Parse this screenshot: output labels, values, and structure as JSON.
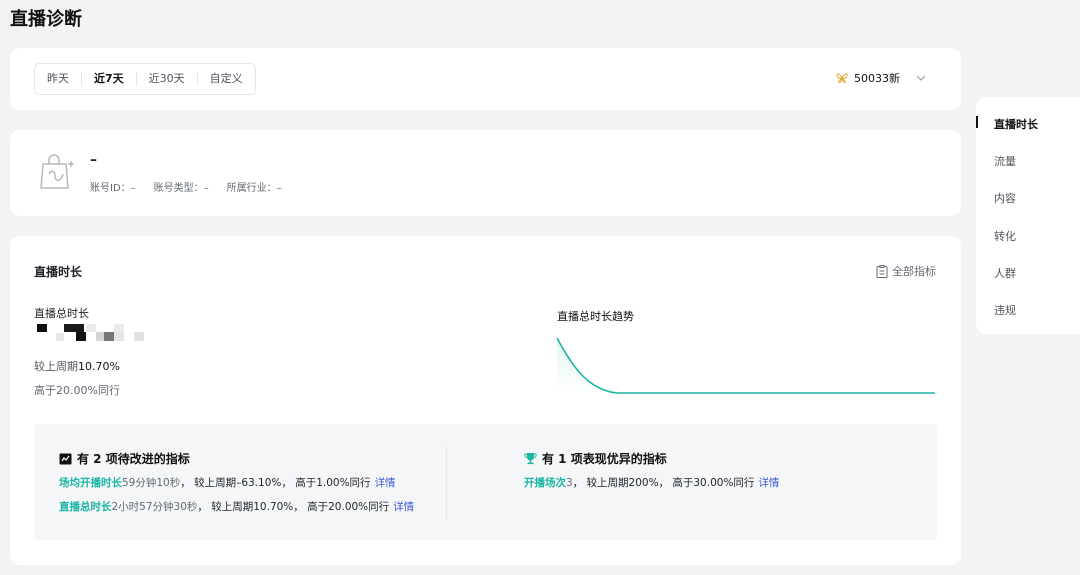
{
  "page_title": "直播诊断",
  "filter": {
    "ranges": [
      "昨天",
      "近7天",
      "近30天",
      "自定义"
    ],
    "active": "近7天",
    "account_label": "50033新"
  },
  "account": {
    "name": "–",
    "id_label": "账号ID：–",
    "type_label": "账号类型：–",
    "industry_label": "所属行业：–"
  },
  "section": {
    "title": "直播时长",
    "all_metrics": "全部指标",
    "total_label": "直播总时长",
    "cmp_prefix": "较上周期",
    "cmp_value": "10.70%",
    "peer_text": "高于20.00%同行",
    "trend_title": "直播总时长趋势"
  },
  "insights": {
    "improve_title": "有 2 项待改进的指标",
    "improve_items": [
      {
        "name": "场均开播时长",
        "value": "59分钟10秒",
        "rest": "， 较上周期–63.10%，  高于1.00%同行",
        "link": "详情"
      },
      {
        "name": "直播总时长",
        "value": "2小时57分钟30秒",
        "rest": "， 较上周期10.70%，  高于20.00%同行",
        "link": "详情"
      }
    ],
    "good_title": "有 1 项表现优异的指标",
    "good_items": [
      {
        "name": "开播场次",
        "value": "3",
        "rest": "， 较上周期200%，  高于30.00%同行",
        "link": "详情"
      }
    ]
  },
  "side_nav": {
    "items": [
      "直播时长",
      "流量",
      "内容",
      "转化",
      "人群",
      "违规"
    ],
    "active": "直播时长"
  },
  "colors": {
    "accent": "#1bb5a5",
    "link": "#3d5bd9",
    "brand_gold": "#e3a92b"
  },
  "icons": [
    "butterfly-icon",
    "chevron-down-icon",
    "shopping-bag-icon",
    "checklist-icon",
    "flag-icon",
    "trophy-icon"
  ]
}
